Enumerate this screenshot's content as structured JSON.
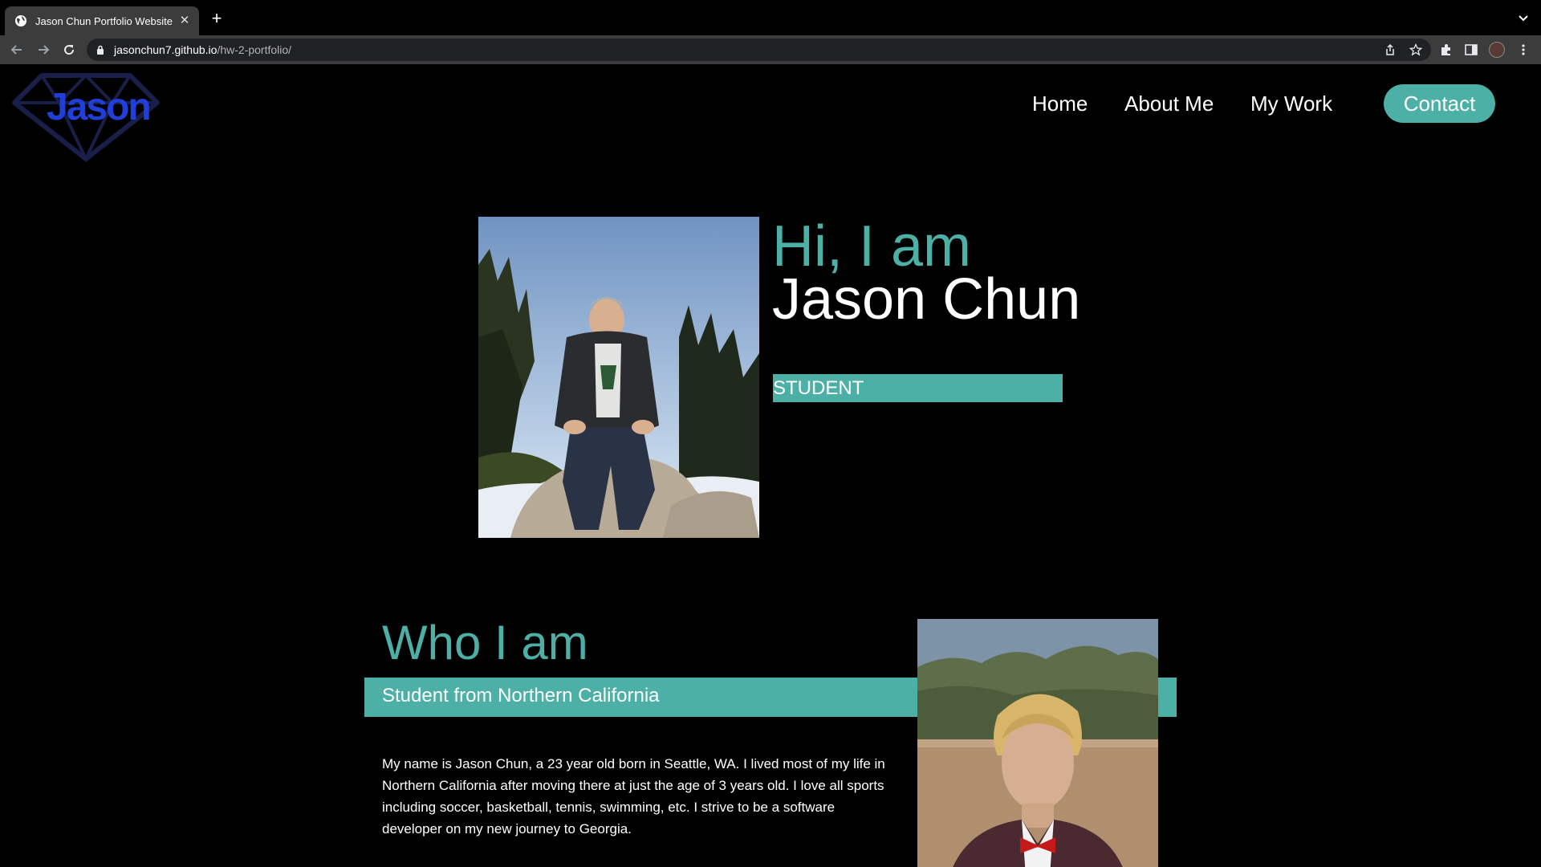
{
  "browser": {
    "tab_title": "Jason Chun Portfolio Website",
    "url_host": "jasonchun7.github.io",
    "url_path": "/hw-2-portfolio/"
  },
  "site": {
    "logo_text": "Jason",
    "nav": {
      "home": "Home",
      "about": "About Me",
      "work": "My Work",
      "contact": "Contact"
    },
    "hero": {
      "greeting": "Hi, I am",
      "name": "Jason Chun",
      "role": "STUDENT"
    },
    "about": {
      "heading": "Who I am",
      "subheading": "Student from Northern California",
      "bio": "My name is Jason Chun, a 23 year old born in Seattle, WA. I lived most of my life in Northern California after moving there at just the age of 3 years old. I love all sports including soccer, basketball, tennis, swimming, etc. I strive to be a software developer on my new journey to Georgia."
    }
  },
  "colors": {
    "accent": "#4db0a6",
    "logo": "#1f3fd8",
    "background": "#000000",
    "chrome": "#3c3c3c"
  },
  "icons": [
    "globe-icon",
    "close-icon",
    "plus-icon",
    "chevron-down-icon",
    "back-icon",
    "forward-icon",
    "reload-icon",
    "lock-icon",
    "share-icon",
    "star-icon",
    "extensions-icon",
    "sidebar-icon",
    "profile-avatar",
    "kebab-menu-icon",
    "diamond-logo-icon"
  ]
}
